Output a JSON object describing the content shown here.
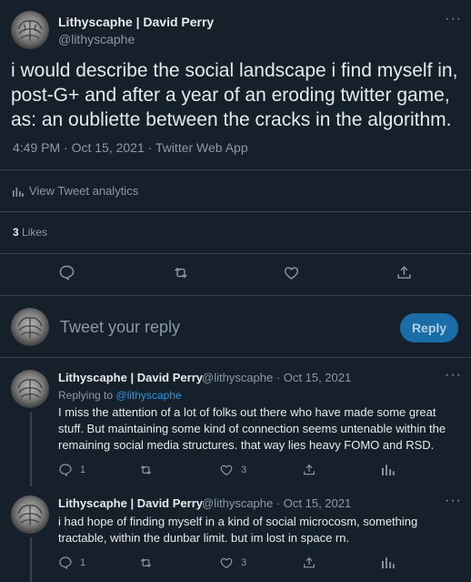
{
  "main_tweet": {
    "author_name": "Lithyscaphe | David Perry",
    "author_handle": "@lithyscaphe",
    "text": "i would describe the social landscape i find myself in, post-G+ and after a year of an eroding twitter game, as: an oubliette between the cracks in the algorithm.",
    "timestamp": "4:49 PM · Oct 15, 2021 · Twitter Web App",
    "analytics_label": "View Tweet analytics",
    "likes_count": "3",
    "likes_label": "Likes"
  },
  "compose": {
    "placeholder": "Tweet your reply",
    "button_label": "Reply"
  },
  "replies": [
    {
      "author_name": "Lithyscaphe | David Perry",
      "meta": "@lithyscaphe · Oct 15, 2021",
      "replying_prefix": "Replying to",
      "replying_handle": "@lithyscaphe",
      "text": "I miss the attention of a lot of folks out there who have made some great stuff. But maintaining some kind of connection seems untenable within the remaining social media structures. that way lies heavy FOMO and RSD.",
      "reply_count": "1",
      "like_count": "3"
    },
    {
      "author_name": "Lithyscaphe | David Perry",
      "meta": "@lithyscaphe · Oct 15, 2021",
      "text": "i had hope of finding myself in a kind of social microcosm, something tractable, within the dunbar limit. but im lost in space rn.",
      "reply_count": "1",
      "like_count": "3"
    }
  ],
  "colors": {
    "background": "#15202b",
    "accent": "#1d9bf0",
    "muted": "#8b98a5",
    "divider": "#38444d"
  }
}
